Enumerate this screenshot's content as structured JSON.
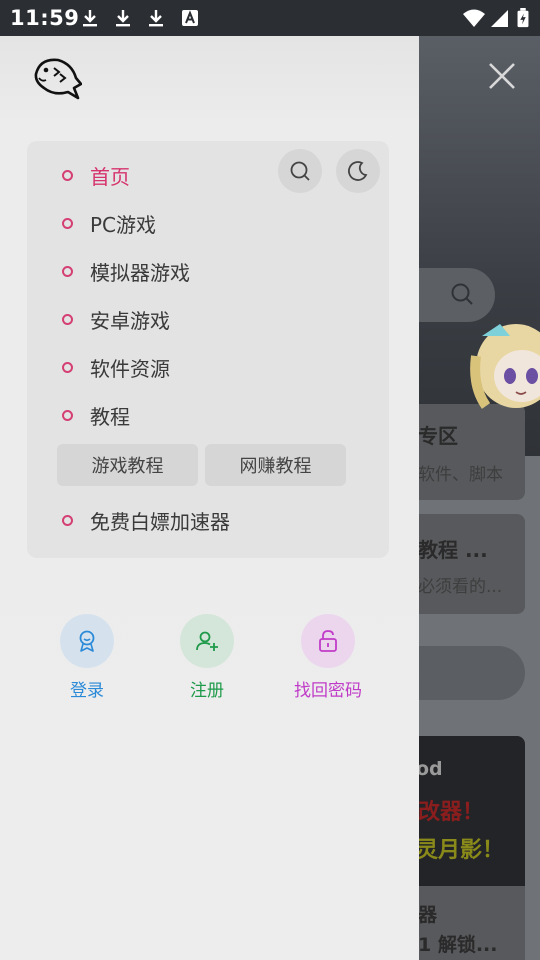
{
  "status_bar": {
    "time": "11:59",
    "left_icons": [
      "download-icon",
      "download-icon",
      "download-icon",
      "a-icon"
    ],
    "right_icons": [
      "wifi-icon",
      "signal-icon",
      "battery-icon"
    ]
  },
  "drawer": {
    "menu": [
      {
        "label": "首页",
        "active": true
      },
      {
        "label": "PC游戏",
        "active": false
      },
      {
        "label": "模拟器游戏",
        "active": false
      },
      {
        "label": "安卓游戏",
        "active": false
      },
      {
        "label": "软件资源",
        "active": false
      },
      {
        "label": "教程",
        "active": false
      }
    ],
    "submenu": [
      "游戏教程",
      "网赚教程"
    ],
    "extra_item": "免费白嫖加速器",
    "actions": [
      {
        "label": "登录",
        "color": "#2b8ad8",
        "bg": "#d5e2ee"
      },
      {
        "label": "注册",
        "color": "#1f9a4a",
        "bg": "#d4e6d9"
      },
      {
        "label": "找回密码",
        "color": "#c03cc8",
        "bg": "#ecd6ee"
      }
    ]
  },
  "background_page": {
    "card1_title": "专区",
    "card1_sub": "软件、脚本",
    "card2_title": "教程 ...",
    "card2_sub": "必须看的...",
    "dark_card_a": "od",
    "dark_card_b": "改器！",
    "dark_card_c": "灵月影！",
    "bottom_t1": "器",
    "bottom_t2": "1 解锁..."
  },
  "colors": {
    "accent": "#d6336c"
  }
}
